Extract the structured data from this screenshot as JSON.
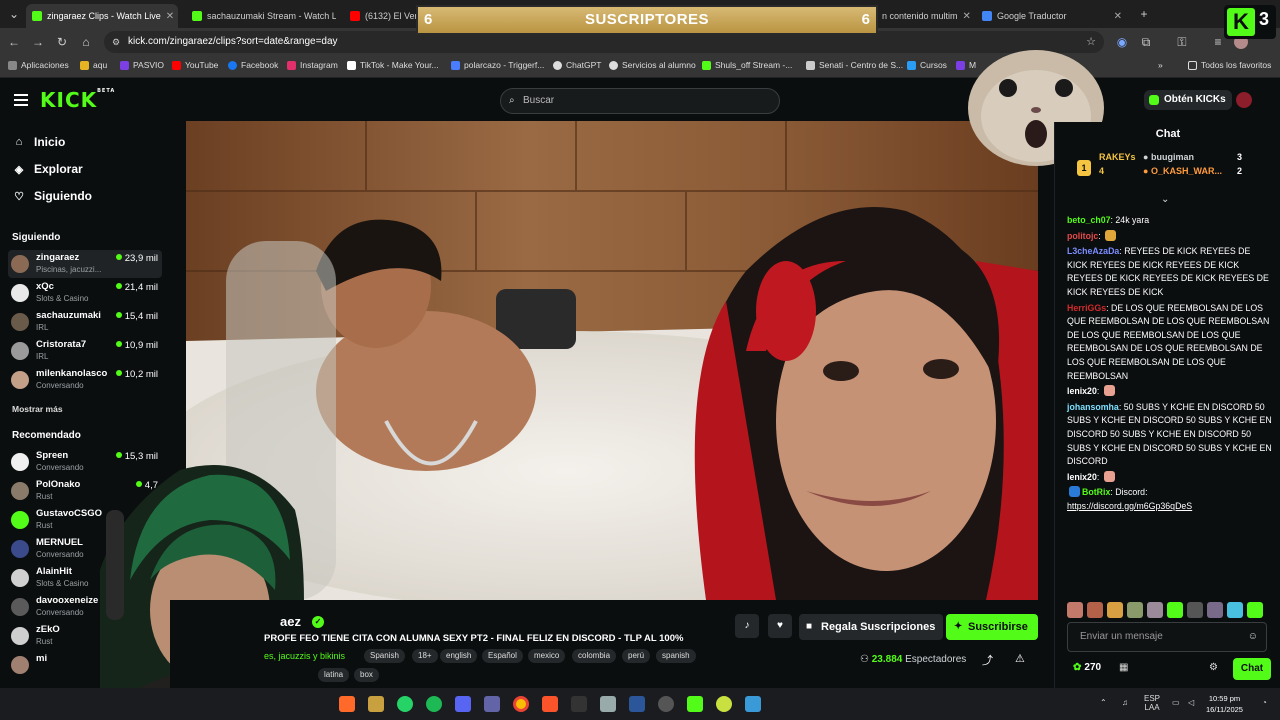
{
  "browser": {
    "tabs": [
      {
        "title": "zingaraez Clips - Watch Live",
        "color": "#53fc18",
        "active": true
      },
      {
        "title": "sachauzumaki Stream - Watch L",
        "color": "#53fc18",
        "active": false
      },
      {
        "title": "(6132) El Vena",
        "color": "#ff0000",
        "active": false
      },
      {
        "title": "n contenido multim",
        "color": "#5b7cfa",
        "active": false
      },
      {
        "title": "Google Traductor",
        "color": "#4285f4",
        "active": false
      }
    ],
    "url": "kick.com/zingaraez/clips?sort=date&range=day",
    "bookmarks": [
      {
        "label": "Aplicaciones",
        "color": "#888888"
      },
      {
        "label": "aqu",
        "color": "#e6b422"
      },
      {
        "label": "PASVIO",
        "color": "#7b3fe4"
      },
      {
        "label": "YouTube",
        "color": "#ff0000"
      },
      {
        "label": "Facebook",
        "color": "#1877f2"
      },
      {
        "label": "Instagram",
        "color": "#e1306c"
      },
      {
        "label": "TikTok - Make Your...",
        "color": "#ffffff"
      },
      {
        "label": "polarcazo - Triggerf...",
        "color": "#4a7cff"
      },
      {
        "label": "ChatGPT",
        "color": "#dddddd"
      },
      {
        "label": "Servicios al alumno",
        "color": "#dddddd"
      },
      {
        "label": "Shuls_off Stream -...",
        "color": "#53fc18"
      },
      {
        "label": "Senati - Centro de S...",
        "color": "#cccccc"
      },
      {
        "label": "Cursos",
        "color": "#2a9df4"
      },
      {
        "label": "M",
        "color": "#7b3fe4"
      }
    ],
    "all_favorites": "Todos los favoritos"
  },
  "kick": {
    "logo": "KICK",
    "logo_sup": "BETA",
    "search_placeholder": "Buscar",
    "get_kicks": "Obtén KICKs"
  },
  "sidebar": {
    "nav": [
      {
        "label": "Inicio",
        "icon": "home-icon",
        "glyph": "⌂"
      },
      {
        "label": "Explorar",
        "icon": "compass-icon",
        "glyph": "◈"
      },
      {
        "label": "Siguiendo",
        "icon": "heart-icon",
        "glyph": "♡"
      }
    ],
    "following_title": "Siguiendo",
    "following": [
      {
        "name": "zingaraez",
        "category": "Piscinas, jacuzzi...",
        "viewers": "23,9 mil",
        "color": "#8a6a55",
        "active": true
      },
      {
        "name": "xQc",
        "category": "Slots & Casino",
        "viewers": "21,4 mil",
        "color": "#e8e8e8",
        "active": false
      },
      {
        "name": "sachauzumaki",
        "category": "IRL",
        "viewers": "15,4 mil",
        "color": "#6a5a4a",
        "active": false
      },
      {
        "name": "Cristorata7",
        "category": "IRL",
        "viewers": "10,9 mil",
        "color": "#9a9a9a",
        "active": false
      },
      {
        "name": "milenkanolasco",
        "category": "Conversando",
        "viewers": "10,2 mil",
        "color": "#c4a088",
        "active": false
      }
    ],
    "show_more": "Mostrar más",
    "recommended_title": "Recomendado",
    "recommended": [
      {
        "name": "Spreen",
        "category": "Conversando",
        "viewers": "15,3 mil",
        "color": "#f0f0f0"
      },
      {
        "name": "PolOnako",
        "category": "Rust",
        "viewers": "4,7",
        "color": "#8a7a6a"
      },
      {
        "name": "GustavoCSGO",
        "category": "Rust",
        "viewers": "",
        "color": "#53fc18"
      },
      {
        "name": "MERNUEL",
        "category": "Conversando",
        "viewers": "",
        "color": "#3a4a8a"
      },
      {
        "name": "AlainHit",
        "category": "Slots & Casino",
        "viewers": "",
        "color": "#d0d0d0"
      },
      {
        "name": "davooxeneize",
        "category": "Conversando",
        "viewers": "",
        "color": "#5a5a5a"
      },
      {
        "name": "zEkO",
        "category": "Rust",
        "viewers": "",
        "color": "#cfcfcf"
      },
      {
        "name": "mi",
        "category": "",
        "viewers": "",
        "color": "#a08070"
      }
    ]
  },
  "stream": {
    "channel": "aez",
    "title": "PROFE FEO TIENE CITA CON ALUMNA SEXY PT2 - FINAL FELIZ EN DISCORD - TLP AL 100%",
    "category": "es, jacuzzis y bikinis",
    "tags": [
      "Spanish",
      "18+",
      "english",
      "Español",
      "mexico",
      "colombia",
      "perú",
      "spanish",
      "latina",
      "box"
    ],
    "gift_label": "Regala Suscripciones",
    "subscribe_label": "Suscribirse",
    "viewers": "23.884",
    "viewers_label": "Espectadores"
  },
  "chat": {
    "title": "Chat",
    "leaderboard": [
      {
        "name": "RAKEYs",
        "count": "4",
        "color": "#f5c542"
      },
      {
        "name": "buugiman",
        "count": "3",
        "color": "#cfd3d5"
      },
      {
        "name": "O_KASH_WAR...",
        "count": "2",
        "color": "#ff9b3d"
      }
    ],
    "leader_badge": "1",
    "messages": [
      {
        "user": "beto_ch07",
        "color": "#53fc18",
        "text": "24k yara"
      },
      {
        "user": "politojc",
        "color": "#e34a4a",
        "text": ""
      },
      {
        "user": "L3cheAzaDa",
        "color": "#7b8cff",
        "text": "REYEES DE KICK  REYEES DE KICK  REYEES DE KICK  REYEES DE KICK  REYEES DE KICK  REYEES DE KICK  REYEES DE KICK  REYEES DE KICK"
      },
      {
        "user": "HerriGGs",
        "color": "#d12a2a",
        "text": "DE LOS QUE REEMBOLSAN  DE LOS QUE REEMBOLSAN  DE LOS QUE REEMBOLSAN  DE LOS QUE REEMBOLSAN  DE LOS QUE REEMBOLSAN  DE LOS QUE REEMBOLSAN  DE LOS QUE REEMBOLSAN  DE LOS QUE REEMBOLSAN"
      },
      {
        "user": "lenix20",
        "color": "#ffffff",
        "text": ""
      },
      {
        "user": "johansomha",
        "color": "#7be0ff",
        "text": "50 SUBS Y KCHE EN DISCORD  50 SUBS Y KCHE EN DISCORD  50 SUBS Y KCHE EN DISCORD  50 SUBS Y KCHE EN DISCORD  50 SUBS Y KCHE EN DISCORD  50 SUBS Y KCHE EN DISCORD"
      },
      {
        "user": "lenix20",
        "color": "#ffffff",
        "text": ""
      },
      {
        "user": "BotRix",
        "color": "#53fc18",
        "text": "Discord:"
      }
    ],
    "botrix_link": "https://discord.gg/m6Gp36qDeS",
    "input_placeholder": "Enviar un mensaje",
    "points": "270",
    "send_label": "Chat"
  },
  "overlay": {
    "subs_left": "6",
    "subs_title": "SUSCRIPTORES",
    "subs_right": "6",
    "kick_count": "3"
  },
  "taskbar": {
    "lang": "ESP",
    "lang2": "LAA",
    "time": "10:59 pm",
    "date": "16/11/2025"
  }
}
